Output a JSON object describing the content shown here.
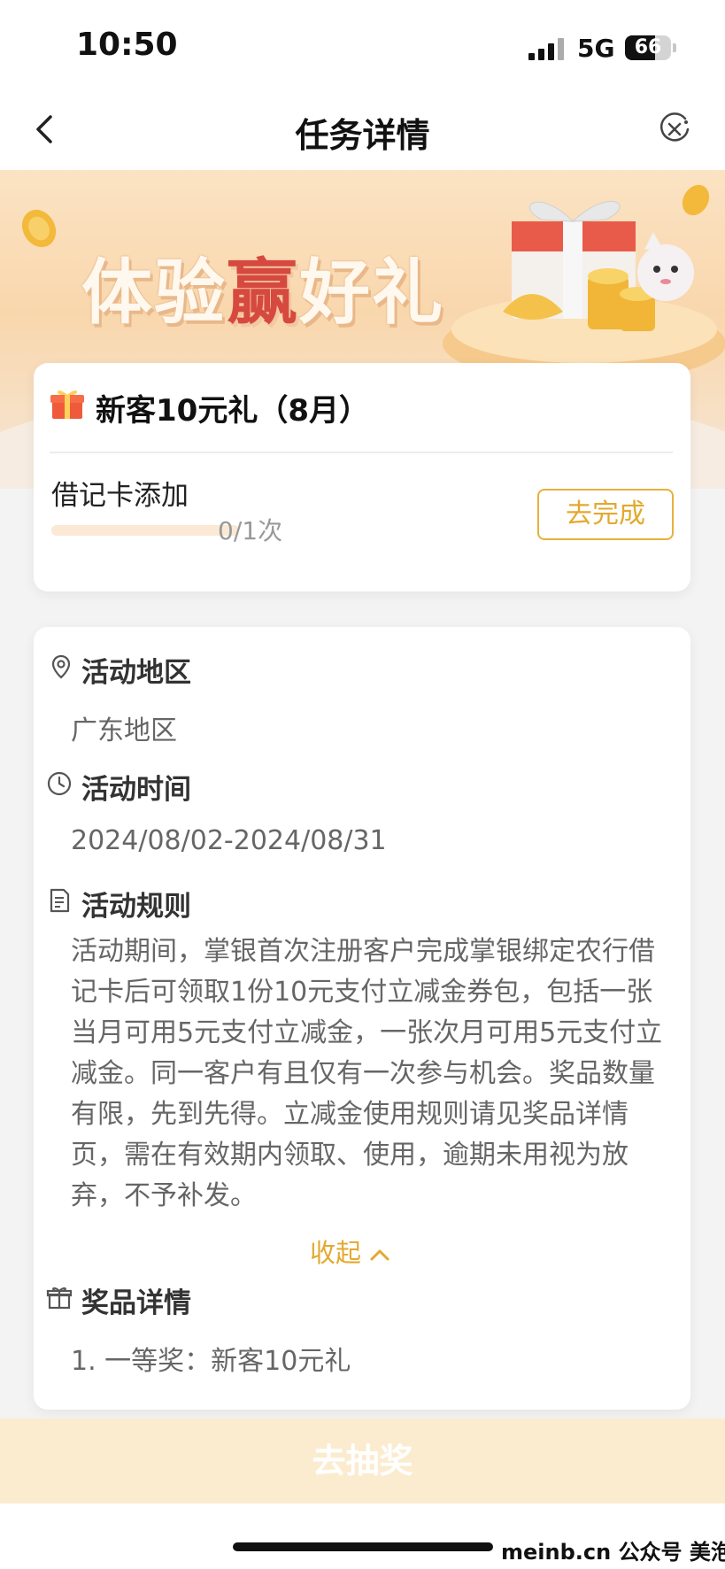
{
  "status_bar": {
    "time": "10:50",
    "network": "5G",
    "battery": "66",
    "battery_level_percent": 66
  },
  "nav": {
    "title": "任务详情",
    "back_icon": "chevron-left-icon",
    "close_icon": "close-circle-icon"
  },
  "banner": {
    "slogan_part1": "体验",
    "slogan_highlight": "赢",
    "slogan_part2": "好礼"
  },
  "task": {
    "title": "新客10元礼（8月）",
    "gift_icon": "gift-icon",
    "subtask_label": "借记卡添加",
    "progress_text": "0/1次",
    "progress_fraction": 0,
    "action_label": "去完成"
  },
  "details": {
    "region_title": "活动地区",
    "region_value": "广东地区",
    "time_title": "活动时间",
    "time_value": "2024/08/02-2024/08/31",
    "rules_title": "活动规则",
    "rules_text": "活动期间，掌银首次注册客户完成掌银绑定农行借记卡后可领取1份10元支付立减金券包，包括一张当月可用5元支付立减金，一张次月可用5元支付立减金。同一客户有且仅有一次参与机会。奖品数量有限，先到先得。立减金使用规则请见奖品详情页，需在有效期内领取、使用，逾期未用视为放弃，不予补发。",
    "collapse_label": "收起",
    "prize_title": "奖品详情",
    "prize_item": "1. 一等奖：新客10元礼"
  },
  "bottom": {
    "draw_label": "去抽奖"
  },
  "watermark": "meinb.cn  公众号 美泡君",
  "colors": {
    "accent": "#e3a92e",
    "banner_bg": "#f9d7ad",
    "highlight_red": "#d6493f",
    "button_disabled_bg": "#fbeccf"
  }
}
